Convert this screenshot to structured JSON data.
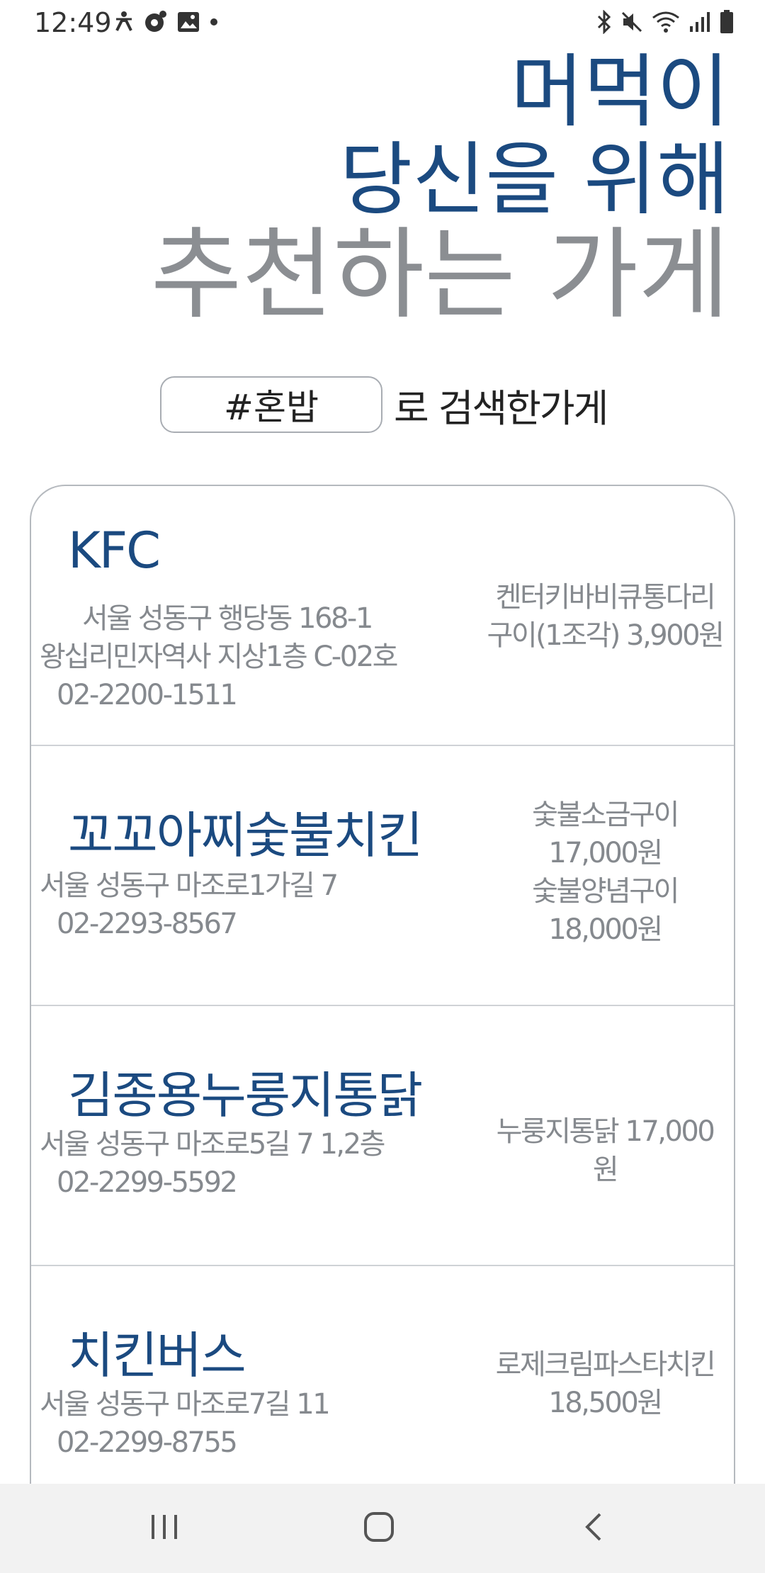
{
  "status_bar": {
    "time": "12:49",
    "left_icons": [
      "accessibility-icon",
      "settings-app-icon",
      "gallery-icon",
      "dot-icon"
    ],
    "right_icons": [
      "bluetooth-icon",
      "mute-icon",
      "wifi-icon",
      "signal-icon",
      "battery-icon"
    ]
  },
  "header": {
    "line1": "머먹이",
    "line2": "당신을 위해",
    "line3": "추천하는 가게"
  },
  "search": {
    "tag": "#혼밥",
    "suffix": "로 검색한가게"
  },
  "stores": [
    {
      "name": "KFC",
      "address_lines": [
        "서울 성동구 행당동 168-1",
        "왕십리민자역사 지상1층 C-02호",
        "02-2200-1511"
      ],
      "menu_lines": [
        "켄터키바비큐통다리",
        "구이(1조각) 3,900원"
      ]
    },
    {
      "name": "꼬꼬아찌숯불치킨",
      "address_lines": [
        "서울 성동구 마조로1가길 7",
        "02-2293-8567"
      ],
      "menu_lines": [
        "숯불소금구이",
        "17,000원",
        "숯불양념구이",
        "18,000원"
      ]
    },
    {
      "name": "김종용누룽지통닭",
      "address_lines": [
        "서울 성동구 마조로5길 7 1,2층",
        "02-2299-5592"
      ],
      "menu_lines": [
        "누룽지통닭 17,000원"
      ]
    },
    {
      "name": "치킨버스",
      "address_lines": [
        "서울 성동구 마조로7길 11",
        "02-2299-8755"
      ],
      "menu_lines": [
        "로제크림파스타치킨",
        "18,500원"
      ]
    }
  ],
  "nav_bar": {
    "buttons": [
      "recents-icon",
      "home-icon",
      "back-icon"
    ]
  },
  "colors": {
    "accent_blue": "#1b4a80",
    "gray_text": "#85898e",
    "nav_bg": "#f2f2f2"
  }
}
